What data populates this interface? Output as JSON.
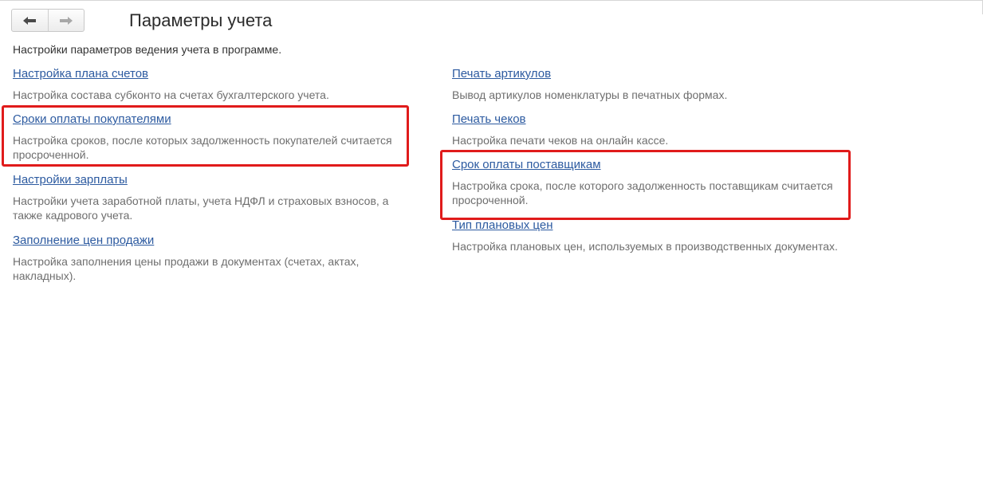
{
  "window": {
    "title": "Параметры учета",
    "subtitle": "Настройки параметров ведения учета в программе."
  },
  "nav": {
    "back_icon": "arrow-left-icon",
    "forward_icon": "arrow-right-icon"
  },
  "left_column": [
    {
      "label": "Настройка плана счетов",
      "description": "Настройка состава субконто на счетах бухгалтерского учета."
    },
    {
      "label": "Сроки оплаты покупателями",
      "description": "Настройка сроков, после которых задолженность покупателей считается просроченной."
    },
    {
      "label": "Настройки зарплаты",
      "description": "Настройки учета заработной платы, учета НДФЛ и страховых взносов, а также кадрового учета."
    },
    {
      "label": "Заполнение цен продажи",
      "description": "Настройка заполнения цены продажи в документах (счетах, актах, накладных)."
    }
  ],
  "right_column": [
    {
      "label": "Печать артикулов",
      "description": "Вывод артикулов номенклатуры в печатных формах."
    },
    {
      "label": "Печать чеков",
      "description": "Настройка печати чеков на онлайн кассе."
    },
    {
      "label": "Срок оплаты поставщикам",
      "description": "Настройка срока, после которого задолженность поставщикам считается просроченной."
    },
    {
      "label": "Тип плановых цен",
      "description": "Настройка плановых цен, используемых в производственных документах."
    }
  ],
  "colors": {
    "link": "#2c5aa0",
    "description": "#6e6e6e",
    "highlight": "#e01b1b"
  }
}
